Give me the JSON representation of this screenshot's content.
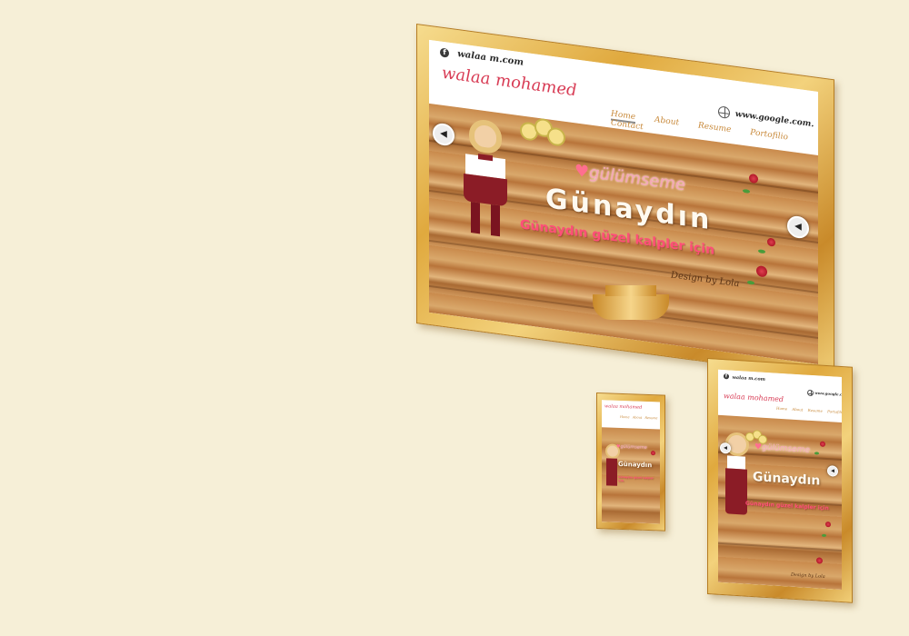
{
  "colors": {
    "background": "#f6efd7",
    "frame": "#e0a93e",
    "brand": "#d83c55",
    "nav": "#c8893a",
    "accent_pink": "#ff4f78"
  },
  "mockup": {
    "facebook_icon": "f",
    "site_url": "walaa m.com",
    "brand_name": "walaa mohamed",
    "nav": [
      "Home",
      "About",
      "Resume",
      "Portofilio",
      "Contact"
    ],
    "search_icon": "globe-icon",
    "search_text": "www.google.com.",
    "prev_arrow": "◀",
    "next_arrow": "◀",
    "heart_icon": "heart-icon",
    "headline_small": "gülümseme",
    "headline_big": "Günaydın",
    "tagline": "Günaydın güzel kalpler için",
    "credit": "Design by Lola"
  }
}
